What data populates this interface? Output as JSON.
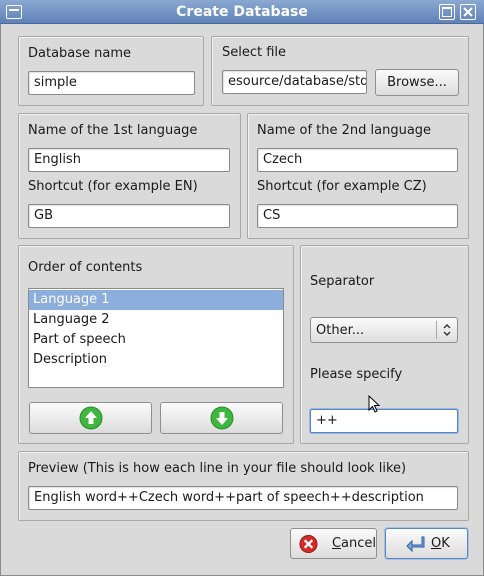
{
  "window": {
    "title": "Create Database"
  },
  "database": {
    "name_label": "Database name",
    "name_value": "simple",
    "file_label": "Select file",
    "file_value": "esource/database/std",
    "browse_label": "Browse..."
  },
  "language1": {
    "name_label": "Name of the 1st language",
    "name_value": "English",
    "shortcut_label": "Shortcut (for example EN)",
    "shortcut_value": "GB"
  },
  "language2": {
    "name_label": "Name of the 2nd language",
    "name_value": "Czech",
    "shortcut_label": "Shortcut (for example CZ)",
    "shortcut_value": "CS"
  },
  "order": {
    "label": "Order of contents",
    "items": [
      "Language 1",
      "Language 2",
      "Part of speech",
      "Description"
    ],
    "selected_index": 0
  },
  "separator": {
    "label": "Separator",
    "selected": "Other...",
    "specify_label": "Please specify",
    "specify_value": "++"
  },
  "preview": {
    "label": "Preview (This is how each line in your file should look like)",
    "value": "English word++Czech word++part of speech++description"
  },
  "buttons": {
    "cancel_mnemonic": "C",
    "cancel_rest": "ancel",
    "ok_mnemonic": "O",
    "ok_rest": "K"
  },
  "colors": {
    "titlebar": "#6f91c4",
    "selection": "#8caedd",
    "arrow_green": "#3fb63f",
    "cancel_red": "#d42a2a"
  }
}
